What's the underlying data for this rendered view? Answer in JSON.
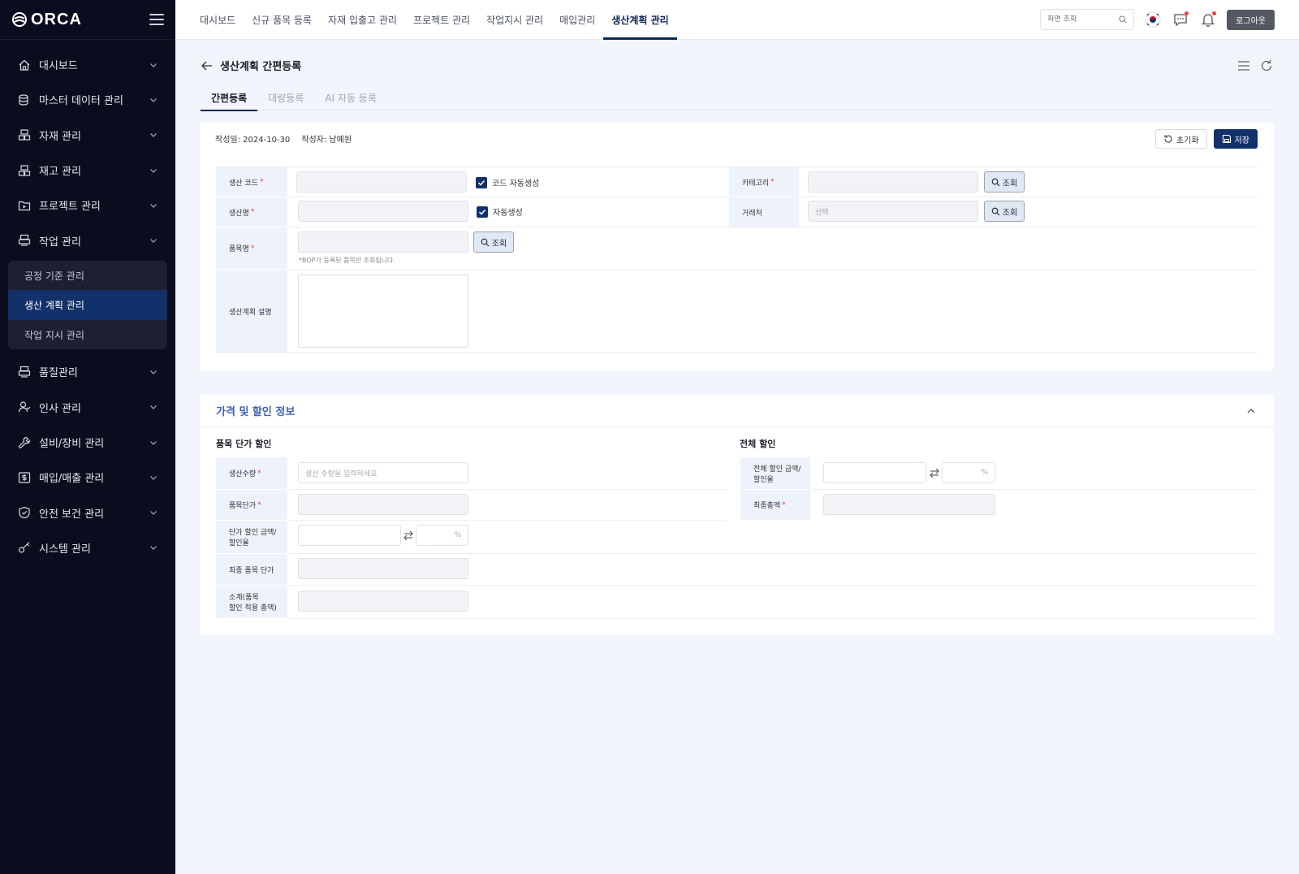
{
  "logo": {
    "text": "ORCA"
  },
  "sidebar": {
    "items": [
      {
        "label": "대시보드",
        "icon": "home-icon"
      },
      {
        "label": "마스터 데이터 관리",
        "icon": "database-icon"
      },
      {
        "label": "자재 관리",
        "icon": "boxes-icon"
      },
      {
        "label": "재고 관리",
        "icon": "boxes-icon"
      },
      {
        "label": "프로젝트 관리",
        "icon": "folder-icon"
      },
      {
        "label": "작업 관리",
        "icon": "printer-icon"
      }
    ],
    "sub_items": [
      {
        "label": "공정 기준 관리",
        "active": false
      },
      {
        "label": "생산 계획 관리",
        "active": true
      },
      {
        "label": "작업 지시 관리",
        "active": false
      }
    ],
    "items_after": [
      {
        "label": "품질관리",
        "icon": "printer-icon"
      },
      {
        "label": "인사 관리",
        "icon": "user-icon"
      },
      {
        "label": "설비/장비 관리",
        "icon": "wrench-icon"
      },
      {
        "label": "매입/매출 관리",
        "icon": "dollar-icon"
      },
      {
        "label": "안전 보건 관리",
        "icon": "shield-icon"
      },
      {
        "label": "시스템 관리",
        "icon": "key-icon"
      }
    ]
  },
  "topnav": {
    "items": [
      "대시보드",
      "신규 품목 등록",
      "자재 입출고 관리",
      "프로젝트 관리",
      "작업지시 관리",
      "매입관리",
      "생산계획 관리"
    ],
    "active_index": 6,
    "search_placeholder": "화면 조회",
    "logout_label": "로그아웃"
  },
  "page": {
    "title": "생산계획 간편등록",
    "tabs": [
      "간편등록",
      "대량등록",
      "AI 자동 등록"
    ],
    "active_tab": 0
  },
  "form": {
    "created_date": "작성일: 2024-10-30",
    "author": "작성자: 남예원",
    "reset_label": "초기화",
    "save_label": "저장",
    "fields": {
      "production_code": "생산 코드",
      "code_autogen": "코드 자동생성",
      "category": "카테고리",
      "production_name": "생산명",
      "autogen": "자동생성",
      "client": "거래처",
      "client_placeholder": "선택",
      "item_name": "품목명",
      "item_hint": "*BOP가 등록된 품목만 조회됩니다.",
      "description": "생산계획 설명",
      "lookup_label": "조회"
    }
  },
  "pricing": {
    "title": "가격 및 할인 정보",
    "unit_section": "품목 단가 할인",
    "total_section": "전체 할인",
    "quantity_label": "생산수량",
    "quantity_placeholder": "생산 수량을 입력하세요",
    "unit_price_label": "품목단가",
    "unit_discount_label_1": "단가 할인 금액/",
    "unit_discount_label_2": "할인율",
    "final_unit_label": "최종 품목 단가",
    "subtotal_label_1": "소계(품목",
    "subtotal_label_2": "할인 적용 총액)",
    "total_discount_label_1": "전체 할인 금액/",
    "total_discount_label_2": "할인율",
    "final_total_label": "최종총액",
    "percent": "%"
  }
}
